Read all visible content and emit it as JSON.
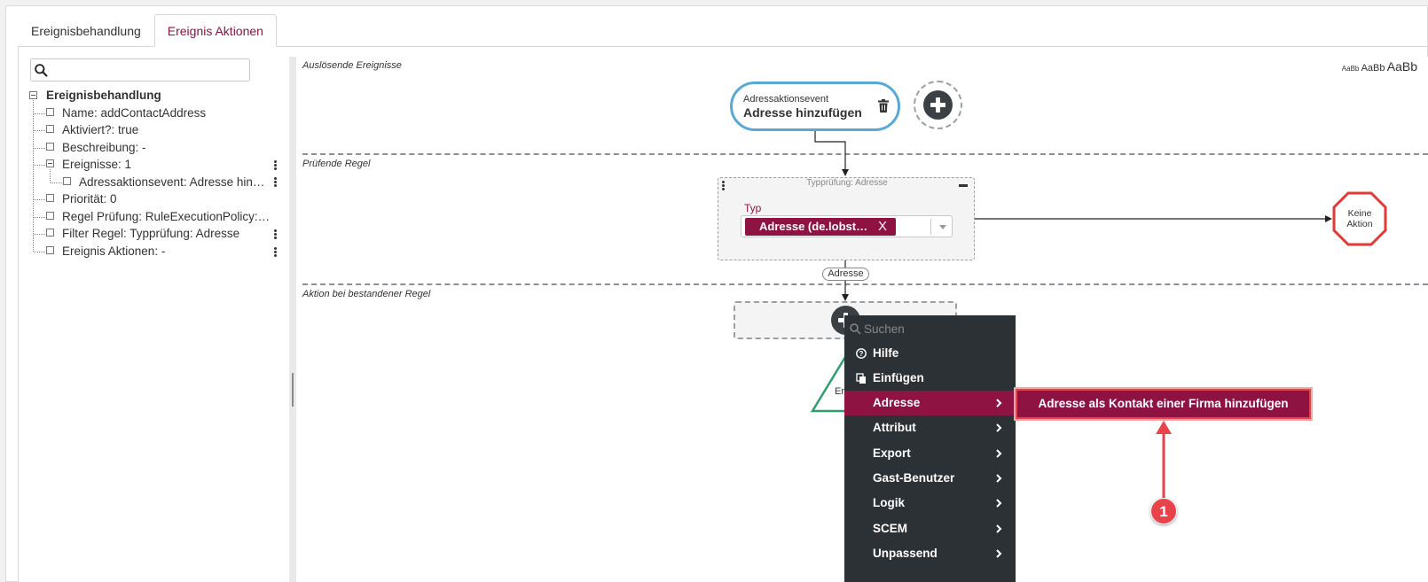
{
  "tabs": [
    {
      "label": "Ereignisbehandlung"
    },
    {
      "label": "Ereignis Aktionen"
    }
  ],
  "tree": {
    "search_placeholder": "",
    "root": "Ereignisbehandlung",
    "items": [
      {
        "label": "Name: addContactAddress"
      },
      {
        "label": "Aktiviert?: true"
      },
      {
        "label": "Beschreibung: -"
      },
      {
        "label": "Ereignisse: 1"
      },
      {
        "label": "Adressaktionsevent: Adresse hin…"
      },
      {
        "label": "Priorität: 0"
      },
      {
        "label": "Regel Prüfung: RuleExecutionPolicy:…"
      },
      {
        "label": "Filter Regel: Typprüfung: Adresse"
      },
      {
        "label": "Ereignis Aktionen: -"
      }
    ]
  },
  "canvas": {
    "font_sizes": [
      "AaBb",
      "AaBb",
      "AaBb"
    ],
    "sections": {
      "trigger": "Auslösende Ereignisse",
      "rule": "Prüfende Regel",
      "action": "Aktion bei bestandener Regel"
    },
    "event_node": {
      "type": "Adressaktionsevent",
      "name": "Adresse hinzufügen"
    },
    "rule_node": {
      "title": "Typprüfung: Adresse",
      "field_label": "Typ",
      "chip": "Adresse (de.lobst…",
      "chip_remove": "X"
    },
    "no_action": {
      "line1": "Keine",
      "line2": "Aktion"
    },
    "edge_label": "Adresse",
    "triangle_text": "Er"
  },
  "context_menu": {
    "search_placeholder": "Suchen",
    "items": [
      {
        "label": "Hilfe",
        "icon": "help-icon"
      },
      {
        "label": "Einfügen",
        "icon": "paste-icon"
      },
      {
        "label": "Adresse",
        "submenu": true
      },
      {
        "label": "Attribut",
        "submenu": true
      },
      {
        "label": "Export",
        "submenu": true
      },
      {
        "label": "Gast-Benutzer",
        "submenu": true
      },
      {
        "label": "Logik",
        "submenu": true
      },
      {
        "label": "SCEM",
        "submenu": true
      },
      {
        "label": "Unpassend",
        "submenu": true
      }
    ],
    "submenu_item": "Adresse als Kontakt einer Firma hinzufügen"
  },
  "annotation": {
    "badge": "1"
  },
  "colors": {
    "brand": "#8e1343",
    "menu_bg": "#2c3135",
    "event_border": "#5aa8d8",
    "stop": "#e53935",
    "action_triangle": "#2e9e6e",
    "annotation": "#e8424a"
  }
}
